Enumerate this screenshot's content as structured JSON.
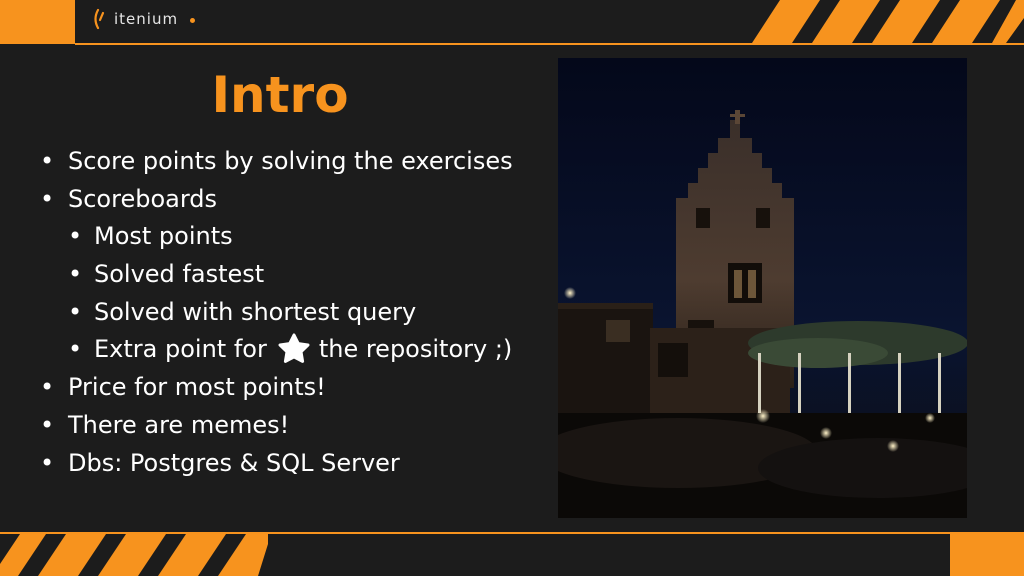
{
  "brand": {
    "name": "itenium",
    "accent": "#f7931e",
    "background": "#1c1c1c"
  },
  "slide": {
    "title": "Intro",
    "bullets": [
      {
        "level": 0,
        "text": "Score points by solving the exercises"
      },
      {
        "level": 0,
        "text": "Scoreboards"
      },
      {
        "level": 1,
        "text": "Most points"
      },
      {
        "level": 1,
        "text": "Solved fastest"
      },
      {
        "level": 1,
        "text": "Solved with shortest query"
      },
      {
        "level": 1,
        "text_before": "Extra point for",
        "icon": "star-icon",
        "text_after": "the repository ;)"
      },
      {
        "level": 0,
        "text": "Price for most points!"
      },
      {
        "level": 0,
        "text": "There are memes!"
      },
      {
        "level": 0,
        "text": "Dbs: Postgres & SQL Server"
      }
    ],
    "bullet_glyph": "•",
    "photo": {
      "subject": "stepped-gable brick house at night"
    }
  }
}
